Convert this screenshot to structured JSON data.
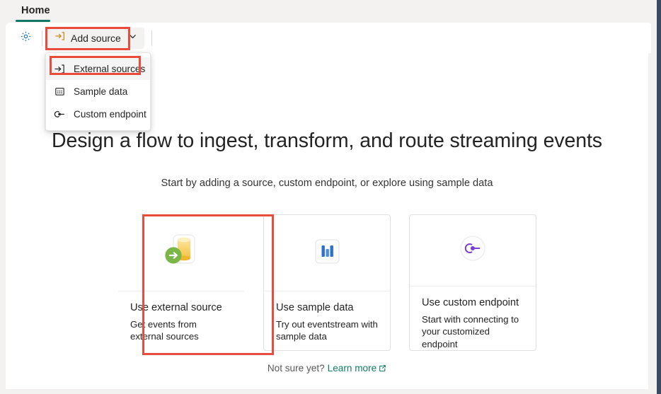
{
  "window": {
    "accent_teal": "#117865",
    "highlight_red": "#e74c3c",
    "canvas_bg": "#ffffff",
    "shell_bg": "#f3f2f1",
    "right_edge_navy": "#3b4a63"
  },
  "tabs": [
    {
      "label": "Home",
      "selected": true
    }
  ],
  "toolbar": {
    "settings_icon": "gear-icon",
    "add_source": {
      "label": "Add source",
      "icon": "import-arrow-icon",
      "chevron": "chevron-down-icon",
      "expanded": true,
      "highlighted": true
    }
  },
  "menu": {
    "open": true,
    "items": [
      {
        "label": "External sources",
        "icon": "import-arrow-icon",
        "selected": true,
        "highlighted": true
      },
      {
        "label": "Sample data",
        "icon": "sample-data-grid-icon",
        "selected": false,
        "highlighted": false
      },
      {
        "label": "Custom endpoint",
        "icon": "custom-endpoint-icon",
        "selected": false,
        "highlighted": false
      }
    ]
  },
  "main": {
    "headline": "Design a flow to ingest, transform, and route streaming events",
    "subhead": "Start by adding a source, custom endpoint, or explore using sample data",
    "cards": [
      {
        "title": "Use external source",
        "description": "Get events from external sources",
        "icon": "database-with-green-arrow-icon",
        "highlighted": true
      },
      {
        "title": "Use sample data",
        "description": "Try out eventstream with sample data",
        "icon": "bar-chart-icon",
        "highlighted": false
      },
      {
        "title": "Use custom endpoint",
        "description": "Start with connecting to your customized endpoint",
        "icon": "custom-endpoint-circle-icon",
        "highlighted": false
      }
    ],
    "footer": {
      "prompt": "Not sure yet?",
      "link_label": "Learn more",
      "link_icon": "external-link-icon"
    }
  }
}
